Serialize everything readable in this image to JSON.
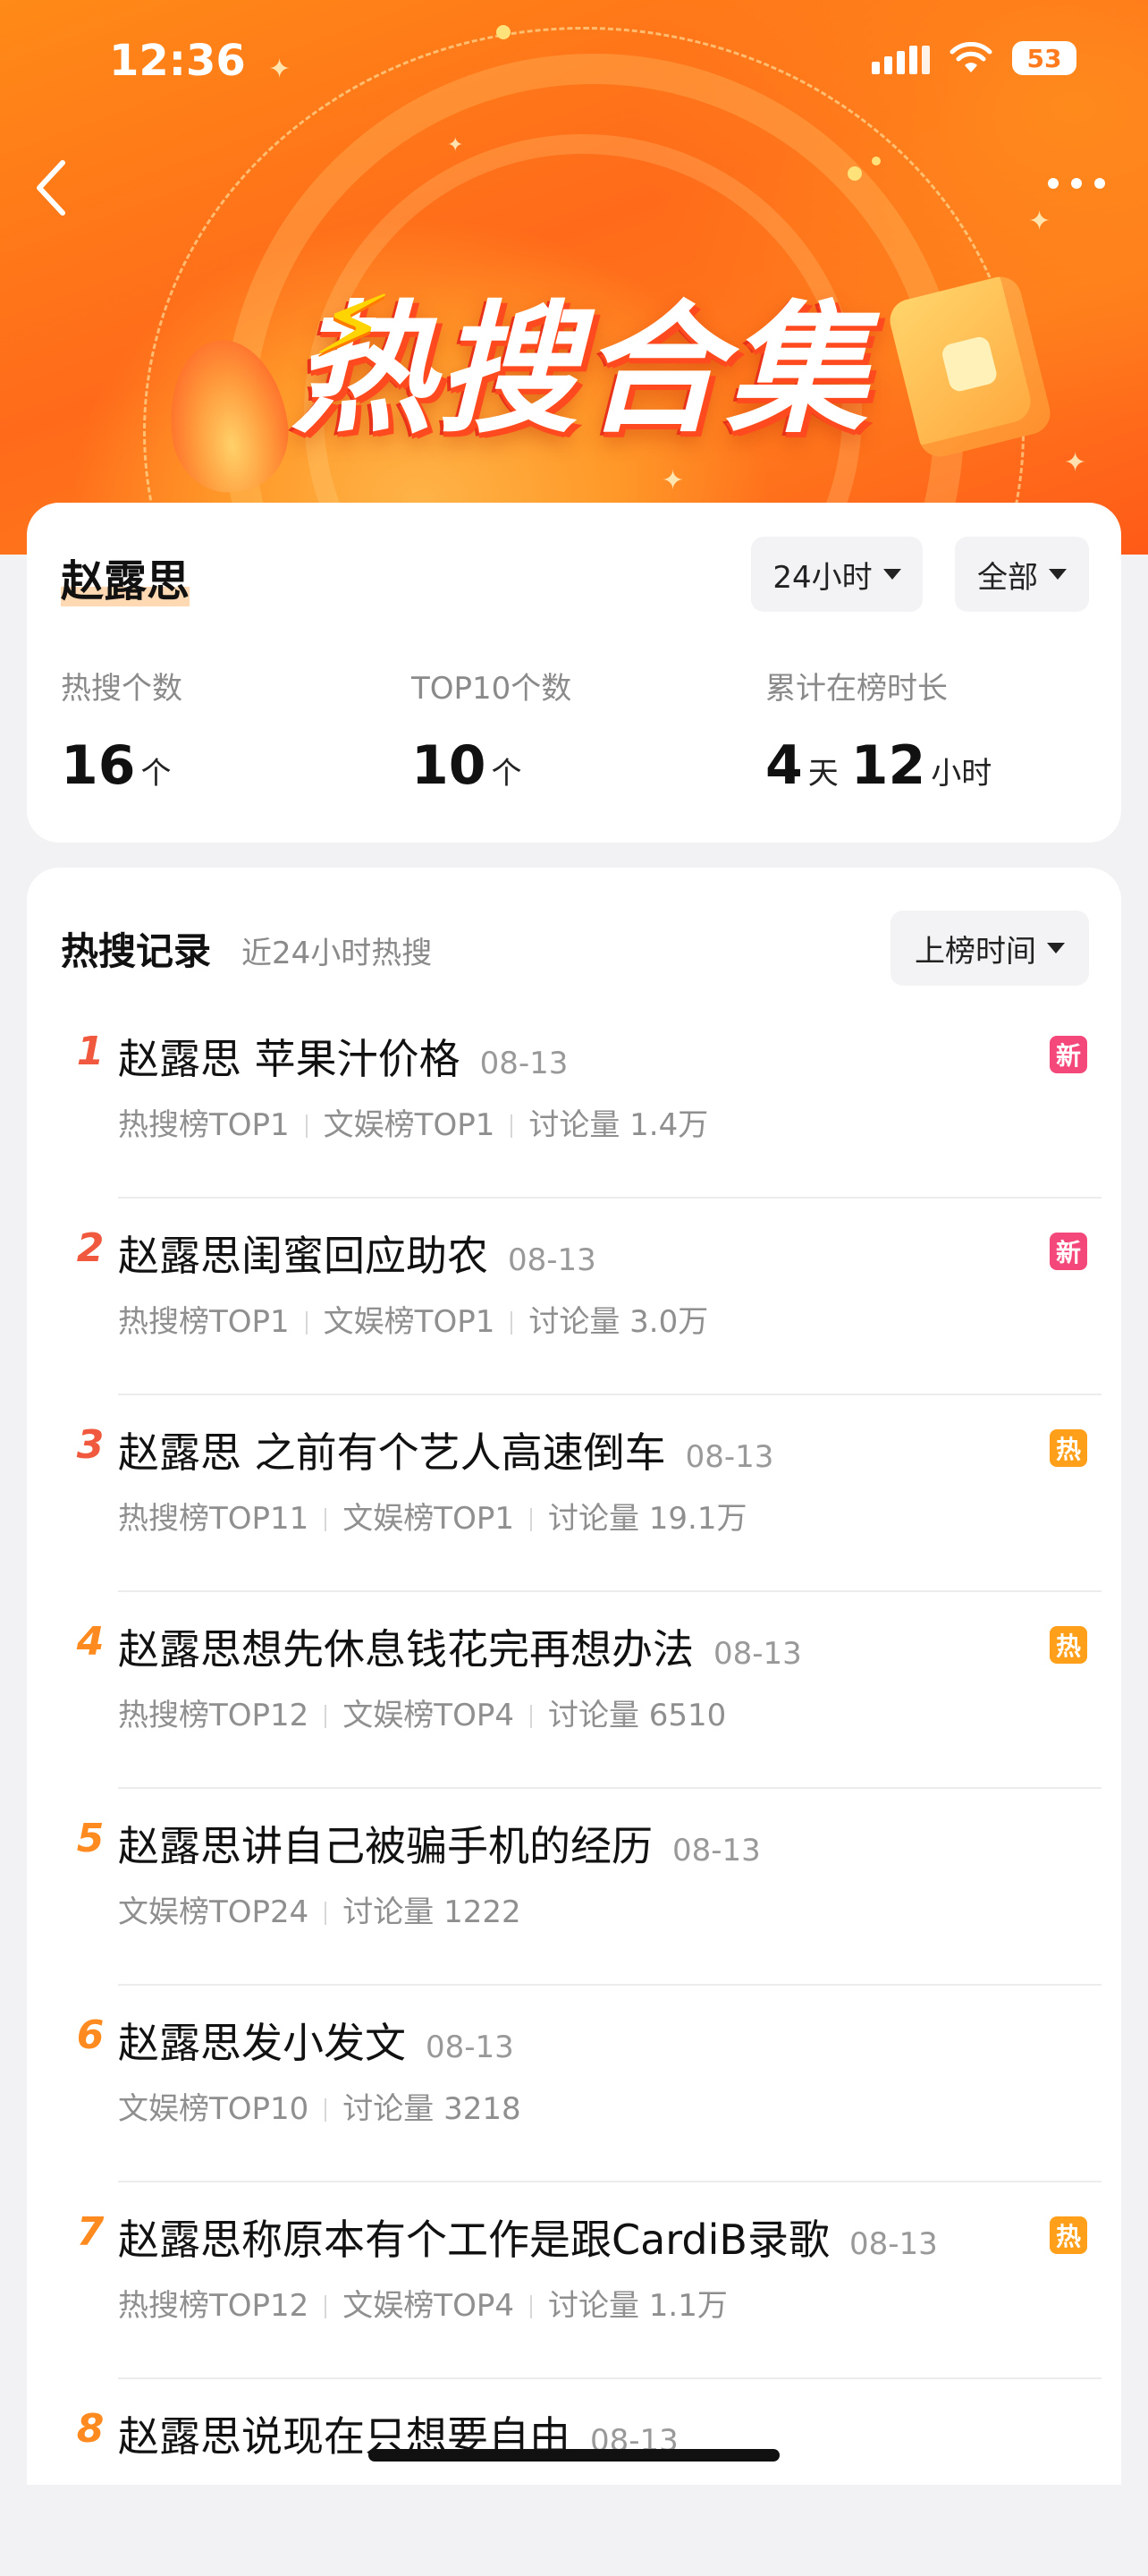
{
  "status_bar": {
    "time": "12:36",
    "battery": "53"
  },
  "hero": {
    "title": "热搜合集"
  },
  "summary": {
    "person": "赵露思",
    "time_filter": "24小时",
    "scope_filter": "全部",
    "stats": [
      {
        "label": "热搜个数",
        "parts": [
          {
            "num": "16",
            "unit": "个"
          }
        ]
      },
      {
        "label": "TOP10个数",
        "parts": [
          {
            "num": "10",
            "unit": "个"
          }
        ]
      },
      {
        "label": "累计在榜时长",
        "parts": [
          {
            "num": "4",
            "unit": "天"
          },
          {
            "num": "12",
            "unit": "小时"
          }
        ]
      }
    ]
  },
  "records": {
    "title": "热搜记录",
    "subtitle": "近24小时热搜",
    "sort_label": "上榜时间",
    "items": [
      {
        "rank": "1",
        "title": "赵露思 苹果汁价格",
        "date": "08-13",
        "meta": [
          "热搜榜TOP1",
          "文娱榜TOP1",
          "讨论量 1.4万"
        ],
        "badge": "新"
      },
      {
        "rank": "2",
        "title": "赵露思闺蜜回应助农",
        "date": "08-13",
        "meta": [
          "热搜榜TOP1",
          "文娱榜TOP1",
          "讨论量 3.0万"
        ],
        "badge": "新"
      },
      {
        "rank": "3",
        "title": "赵露思 之前有个艺人高速倒车",
        "date": "08-13",
        "meta": [
          "热搜榜TOP11",
          "文娱榜TOP1",
          "讨论量 19.1万"
        ],
        "badge": "热"
      },
      {
        "rank": "4",
        "title": "赵露思想先休息钱花完再想办法",
        "date": "08-13",
        "meta": [
          "热搜榜TOP12",
          "文娱榜TOP4",
          "讨论量 6510"
        ],
        "badge": "热"
      },
      {
        "rank": "5",
        "title": "赵露思讲自己被骗手机的经历",
        "date": "08-13",
        "meta": [
          "文娱榜TOP24",
          "讨论量 1222"
        ],
        "badge": ""
      },
      {
        "rank": "6",
        "title": "赵露思发小发文",
        "date": "08-13",
        "meta": [
          "文娱榜TOP10",
          "讨论量 3218"
        ],
        "badge": ""
      },
      {
        "rank": "7",
        "title": "赵露思称原本有个工作是跟CardiB录歌",
        "date": "08-13",
        "meta": [
          "热搜榜TOP12",
          "文娱榜TOP4",
          "讨论量 1.1万"
        ],
        "badge": "热"
      },
      {
        "rank": "8",
        "title": "赵露思说现在只想要自由",
        "date": "08-13",
        "meta": [],
        "badge": ""
      }
    ]
  },
  "colors": {
    "rank_top3": "#f0593d",
    "rank_rest": "#ff8a1f",
    "badge_new": "#f5487a",
    "badge_hot": "#ff9f1a"
  }
}
